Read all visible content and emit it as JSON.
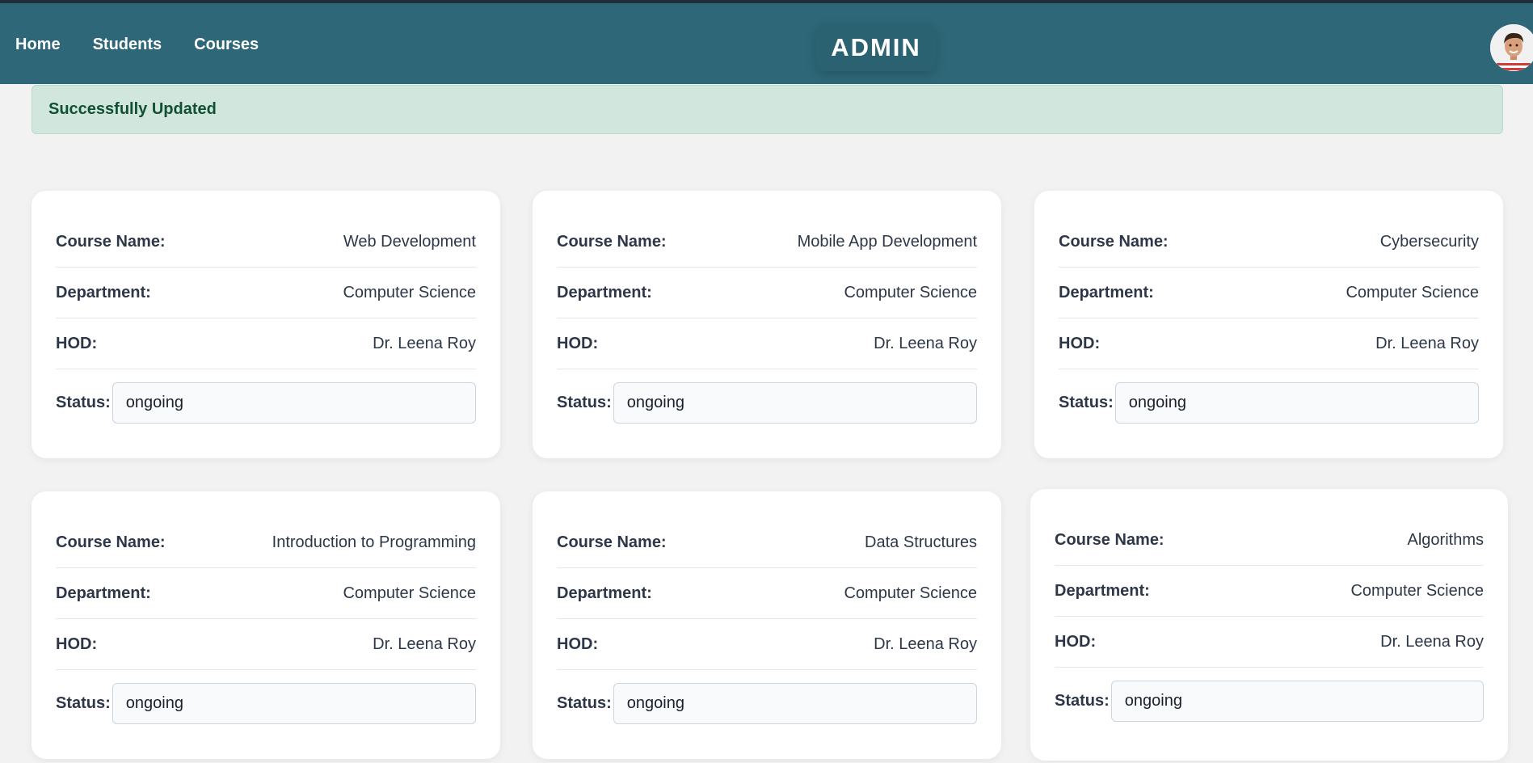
{
  "nav": {
    "items": [
      {
        "label": "Home"
      },
      {
        "label": "Students"
      },
      {
        "label": "Courses"
      }
    ]
  },
  "brand": {
    "title": "ADMIN"
  },
  "alert": {
    "message": "Successfully Updated"
  },
  "labels": {
    "course_name": "Course Name:",
    "department": "Department:",
    "hod": "HOD:",
    "status": "Status:"
  },
  "courses": [
    {
      "name": "Web Development",
      "department": "Computer Science",
      "hod": "Dr. Leena Roy",
      "status": "ongoing"
    },
    {
      "name": "Mobile App Development",
      "department": "Computer Science",
      "hod": "Dr. Leena Roy",
      "status": "ongoing"
    },
    {
      "name": "Cybersecurity",
      "department": "Computer Science",
      "hod": "Dr. Leena Roy",
      "status": "ongoing"
    },
    {
      "name": "Introduction to Programming",
      "department": "Computer Science",
      "hod": "Dr. Leena Roy",
      "status": "ongoing"
    },
    {
      "name": "Data Structures",
      "department": "Computer Science",
      "hod": "Dr. Leena Roy",
      "status": "ongoing"
    },
    {
      "name": "Algorithms",
      "department": "Computer Science",
      "hod": "Dr. Leena Roy",
      "status": "ongoing"
    }
  ]
}
